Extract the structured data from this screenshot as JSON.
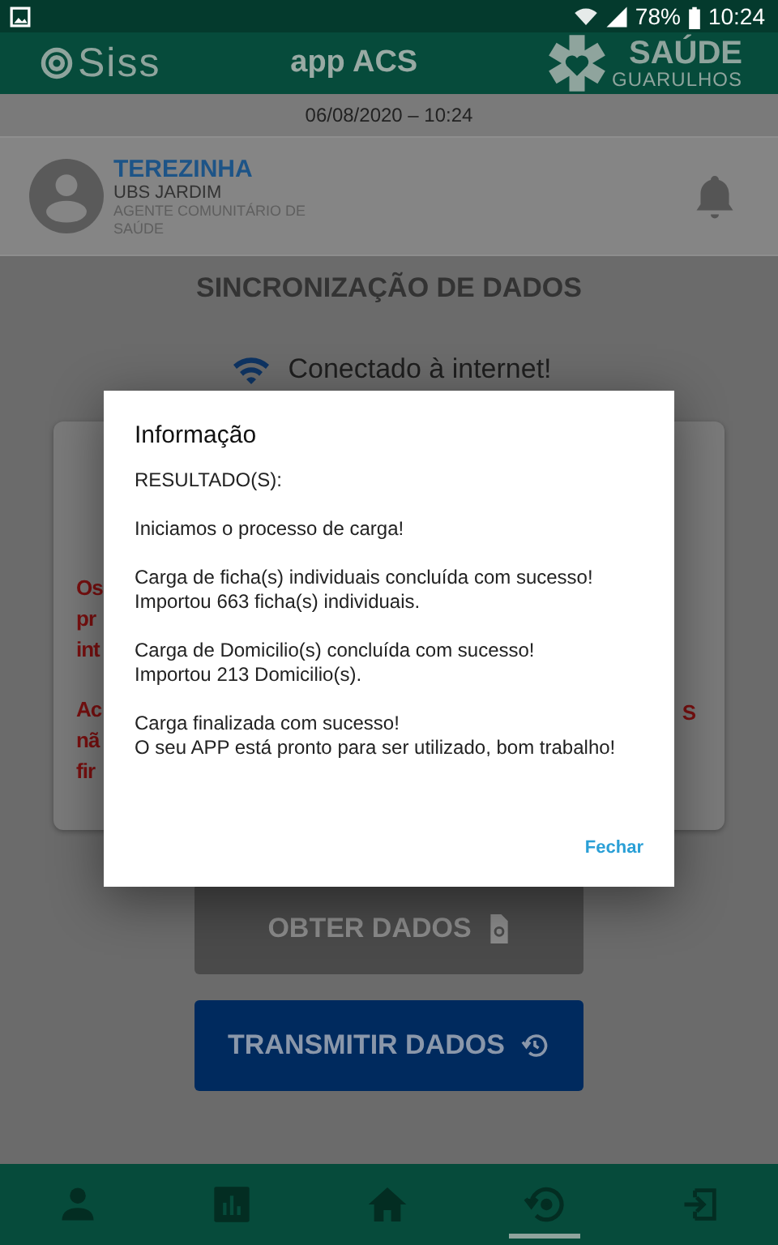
{
  "status_bar": {
    "battery": "78%",
    "time": "10:24"
  },
  "header": {
    "brand": "Siss",
    "title": "app ACS",
    "partner": {
      "name": "SAÚDE",
      "city": "GUARULHOS"
    }
  },
  "date": "06/08/2020 – 10:24",
  "user": {
    "name": "TEREZINHA",
    "unit": "UBS JARDIM",
    "role": "AGENTE COMUNITÁRIO DE SAÚDE"
  },
  "page_title": "SINCRONIZAÇÃO DE DADOS",
  "connection": {
    "text": "Conectado à internet!"
  },
  "notice_card": {
    "left_fragments": [
      [
        "Os",
        "pr",
        "int"
      ],
      [
        "Ac",
        "nã",
        "fir"
      ]
    ],
    "right_fragments": [
      "S"
    ]
  },
  "buttons": [
    {
      "kind": "get",
      "label": "OBTER DADOS"
    },
    {
      "kind": "transmit",
      "label": "TRANSMITIR DADOS"
    }
  ],
  "dialog": {
    "title": "Informação",
    "paragraphs": [
      [
        "RESULTADO(S):"
      ],
      [
        "Iniciamos o processo de carga!"
      ],
      [
        "Carga de ficha(s) individuais concluída com sucesso!",
        "Importou 663 ficha(s) individuais."
      ],
      [
        "Carga de Domicilio(s) concluída com sucesso!",
        "Importou 213 Domicilio(s)."
      ],
      [
        "Carga finalizada com sucesso!",
        "O seu APP está pronto para ser utilizado, bom trabalho!"
      ]
    ],
    "action": "Fechar"
  },
  "bottom_nav": [
    {
      "kind": "profile",
      "selected": false
    },
    {
      "kind": "reports",
      "selected": false
    },
    {
      "kind": "home",
      "selected": false
    },
    {
      "kind": "sync",
      "selected": true
    },
    {
      "kind": "logout",
      "selected": false
    }
  ]
}
